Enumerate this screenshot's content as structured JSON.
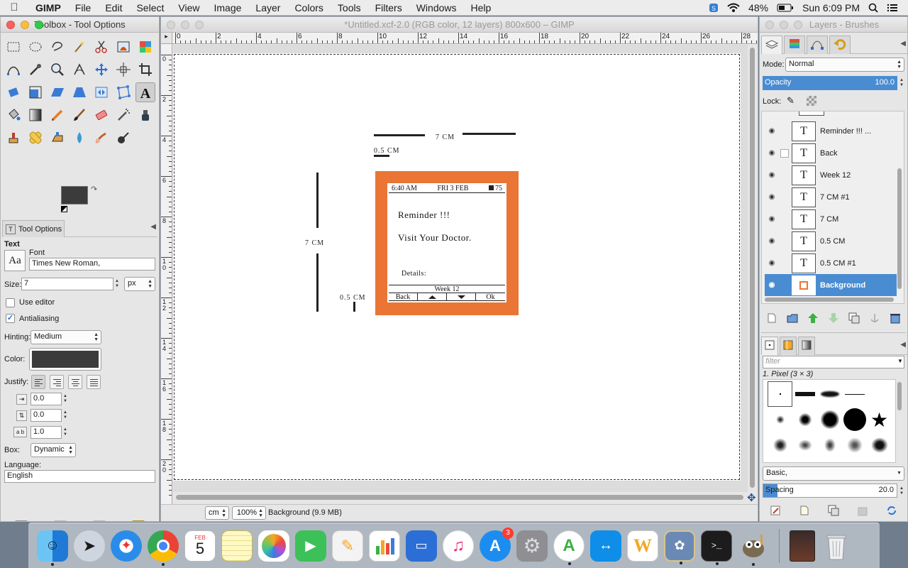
{
  "menubar": {
    "app_name": "GIMP",
    "items": [
      "File",
      "Edit",
      "Select",
      "View",
      "Image",
      "Layer",
      "Colors",
      "Tools",
      "Filters",
      "Windows",
      "Help"
    ],
    "battery": "48%",
    "clock": "Sun 6:09 PM"
  },
  "toolbox": {
    "title": "Toolbox - Tool Options",
    "tool_options_tab": "Tool Options",
    "section": "Text",
    "font_label": "Font",
    "font_preview": "Aa",
    "font_value": "Times New Roman,",
    "size_label": "Size:",
    "size_value": "7",
    "size_unit": "px",
    "use_editor": "Use editor",
    "antialiasing": "Antialiasing",
    "hinting_label": "Hinting:",
    "hinting_value": "Medium",
    "color_label": "Color:",
    "text_color": "#3b3b3b",
    "justify_label": "Justify:",
    "indent_value": "0.0",
    "line_spacing_value": "0.0",
    "letter_spacing_value": "1.0",
    "box_label": "Box:",
    "box_value": "Dynamic",
    "language_label": "Language:",
    "language_value": "English",
    "fg_color": "#3b3b3b",
    "bg_color": "#ffffff"
  },
  "image_window": {
    "title": "*Untitled.xcf-2.0 (RGB color, 12 layers) 800x600 – GIMP",
    "hruler_labels": [
      "0",
      "2",
      "4",
      "6",
      "8",
      "10",
      "12",
      "14",
      "16",
      "18",
      "20",
      "22",
      "24",
      "26",
      "28"
    ],
    "vruler_labels": [
      "0",
      "2",
      "4",
      "6",
      "8",
      "1\n0",
      "1\n2",
      "1\n4",
      "1\n6",
      "1\n8",
      "2\n0"
    ],
    "unit": "cm",
    "zoom": "100%",
    "status_text": "Background (9.9 MB)"
  },
  "canvas": {
    "top_width_label": "7 CM",
    "small_top_label": "0.5 CM",
    "left_height_label": "7 CM",
    "small_left_label": "0.5 CM",
    "device_color": "#ea7535",
    "screen": {
      "time": "6:40 AM",
      "date": "FRI 3 FEB",
      "battery_value": "75",
      "reminder": "Reminder !!!",
      "message": "Visit Your Doctor.",
      "details": "Details:",
      "week": "Week 12",
      "back": "Back",
      "ok": "Ok"
    }
  },
  "layers_window": {
    "title": "Layers - Brushes",
    "mode_label": "Mode:",
    "mode_value": "Normal",
    "opacity_label": "Opacity",
    "opacity_value": "100.0",
    "lock_label": "Lock:",
    "layers": [
      {
        "name": "Reminder !!! ...",
        "selected": false
      },
      {
        "name": "Back",
        "selected": false
      },
      {
        "name": "Week 12",
        "selected": false
      },
      {
        "name": "7 CM #1",
        "selected": false
      },
      {
        "name": "7 CM",
        "selected": false
      },
      {
        "name": "0.5 CM",
        "selected": false
      },
      {
        "name": "0.5 CM #1",
        "selected": false
      },
      {
        "name": "Background",
        "selected": true
      }
    ],
    "brush_filter_placeholder": "filter",
    "brush_name": "1. Pixel (3 × 3)",
    "brush_preset": "Basic,",
    "spacing_label": "Spacing",
    "spacing_value": "20.0"
  },
  "dock": {
    "calendar_month": "FEB",
    "calendar_day": "5",
    "appstore_badge": "3"
  },
  "colors": {
    "accent": "#4a8cd1",
    "selection_blue": "#4a8cd1"
  }
}
